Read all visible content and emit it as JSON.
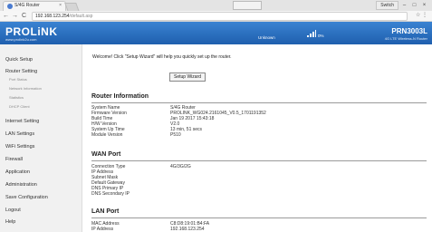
{
  "browser": {
    "tab_title": "S/4G Router",
    "tab_close": "×",
    "user_button": "Switch",
    "window_controls": [
      "–",
      "□",
      "×"
    ],
    "nav": {
      "back": "←",
      "forward": "→",
      "reload": "C"
    },
    "url_host": "192.168.123.254",
    "url_path": "/default.asp",
    "right_icons": "☆ ⋮"
  },
  "router_header": {
    "logo": "PROLiNK",
    "logo_sub": "www.prolink2u.com",
    "sim_status": "Unknown",
    "battery": "0%",
    "model": "PRN3003L",
    "model_sub": "4G LTE Wireless-N Router"
  },
  "sidebar": {
    "items": [
      {
        "label": "Quick Setup"
      },
      {
        "label": "Router Setting"
      },
      {
        "label": "Internet Setting"
      },
      {
        "label": "LAN Settings"
      },
      {
        "label": "WiFi Settings"
      },
      {
        "label": "Firewall"
      },
      {
        "label": "Application"
      },
      {
        "label": "Administration"
      },
      {
        "label": "Save Configuration"
      },
      {
        "label": "Logout"
      },
      {
        "label": "Help"
      }
    ],
    "subitems": [
      {
        "label": "Port Status"
      },
      {
        "label": "Network Information"
      },
      {
        "label": "Statistics"
      },
      {
        "label": "DHCP Client"
      }
    ]
  },
  "main": {
    "welcome": "Welcome! Click \"Setup Wizard\" will help you quickly set up the router.",
    "wizard_button": "Setup Wizard",
    "router_info": {
      "title": "Router Information",
      "rows": [
        {
          "label": "System Name",
          "value": "S/4G Router"
        },
        {
          "label": "Firmware Version",
          "value": "PROLINK_WG024.2161045_V0.5_1701191352"
        },
        {
          "label": "Build Time",
          "value": "Jan 19 2017 15:43:18"
        },
        {
          "label": "H/W Version",
          "value": "V2.0"
        },
        {
          "label": "System Up Time",
          "value": "13 min, 51 secs"
        },
        {
          "label": "Module Version",
          "value": "P510"
        }
      ]
    },
    "wan_port": {
      "title": "WAN Port",
      "rows": [
        {
          "label": "Connection Type",
          "value": "4G/3G/2G"
        },
        {
          "label": "IP Address",
          "value": ""
        },
        {
          "label": "Subnet Mask",
          "value": ""
        },
        {
          "label": "Default Gateway",
          "value": ""
        },
        {
          "label": "DNS Primary IP",
          "value": ""
        },
        {
          "label": "DNS Secondary IP",
          "value": ""
        }
      ]
    },
    "lan_port": {
      "title": "LAN Port",
      "rows": [
        {
          "label": "MAC Address",
          "value": "C8:D8:19:01:B4:FA"
        },
        {
          "label": "IP Address",
          "value": "192.168.123.254"
        }
      ]
    }
  }
}
